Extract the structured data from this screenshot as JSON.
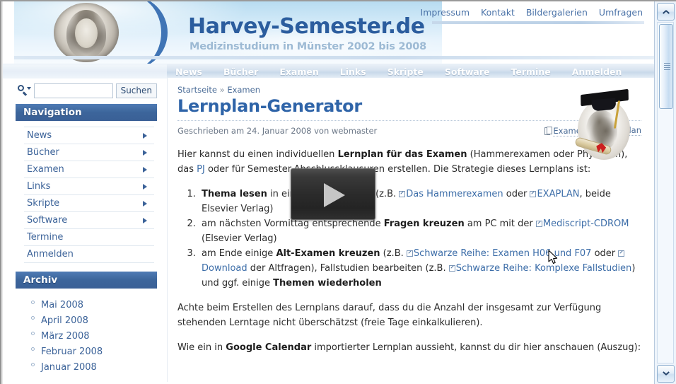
{
  "header": {
    "site_title": "Harvey-Semester.de",
    "site_subtitle": "Medizinstudium in Münster 2002 bis 2008",
    "portrait_alt": "william-harvey-portrait",
    "top_links": [
      {
        "label": "Impressum"
      },
      {
        "label": "Kontakt"
      },
      {
        "label": "Bildergalerien"
      },
      {
        "label": "Umfragen"
      }
    ]
  },
  "navbar": {
    "items": [
      {
        "label": "News"
      },
      {
        "label": "Bücher"
      },
      {
        "label": "Examen"
      },
      {
        "label": "Links"
      },
      {
        "label": "Skripte"
      },
      {
        "label": "Software"
      },
      {
        "label": "Termine"
      },
      {
        "label": "Anmelden"
      }
    ]
  },
  "sidebar": {
    "search": {
      "value": "",
      "placeholder": "",
      "button_label": "Suchen",
      "icon": "search-icon"
    },
    "navigation": {
      "title": "Navigation",
      "items": [
        {
          "label": "News",
          "has_submenu": true
        },
        {
          "label": "Bücher",
          "has_submenu": true
        },
        {
          "label": "Examen",
          "has_submenu": true
        },
        {
          "label": "Links",
          "has_submenu": true
        },
        {
          "label": "Skripte",
          "has_submenu": true
        },
        {
          "label": "Software",
          "has_submenu": true
        },
        {
          "label": "Termine",
          "has_submenu": false
        },
        {
          "label": "Anmelden",
          "has_submenu": false
        }
      ]
    },
    "archive": {
      "title": "Archiv",
      "items": [
        {
          "label": "Mai 2008"
        },
        {
          "label": "April 2008"
        },
        {
          "label": "März 2008"
        },
        {
          "label": "Februar 2008"
        },
        {
          "label": "Januar 2008"
        }
      ]
    }
  },
  "content": {
    "breadcrumb": {
      "home": "Startseite",
      "separator": "»",
      "current": "Examen"
    },
    "title": "Lernplan-Generator",
    "byline": "Geschrieben am 24. Januar 2008 von webmaster",
    "tags": [
      {
        "label": "Examen",
        "icon": "tag-icon"
      },
      {
        "label": "Lernplan",
        "icon": ""
      }
    ],
    "intro": {
      "t1": "Hier kannst du einen individuellen ",
      "b1": "Lernplan für das Examen",
      "t2": " (Hammerexamen oder Physikum), das ",
      "l1": "PJ",
      "t3": " oder für Semester-Abschlussklausuren erstellen. Die Strategie dieses Lernplans ist:"
    },
    "steps": [
      {
        "b1": "Thema lesen",
        "t1": " in einem Repetitorium (z.B. ",
        "l1": "Das Hammerexamen",
        "t2": " oder ",
        "l2": "EXAPLAN",
        "t3": ", beide Elsevier Verlag)"
      },
      {
        "t1": "am nächsten Vormittag entsprechende ",
        "b1": "Fragen kreuzen",
        "t2": " am PC mit der ",
        "l1": "Mediscript-CDROM",
        "t3": " (Elsevier Verlag)"
      },
      {
        "t1": "am Ende einige ",
        "b1": "Alt-Examen kreuzen",
        "t2": " (z.B. ",
        "l1": "Schwarze Reihe: Examen H06 und F07",
        "t3": " oder ",
        "l2": "Download",
        "t4": " der Altfragen), Fallstudien bearbeiten (z.B. ",
        "l3": "Schwarze Reihe: Komplexe Fallstudien",
        "t5": ") und ggf. einige ",
        "b2": "Themen wiederholen"
      }
    ],
    "note": "Achte beim Erstellen des Lernplans darauf, dass du die Anzahl der insgesamt zur Verfügung stehenden Lerntage nicht überschätzst (freie Tage einkalkulieren).",
    "calendar": {
      "t1": "Wie ein in ",
      "b1": "Google Calendar",
      "t2": " importierter Lernplan aussieht, kannst du dir hier anschauen (Auszug):"
    },
    "video_overlay": {
      "icon": "play-icon",
      "label": ""
    },
    "image_alt": "graduate-portrait"
  },
  "scrollbar": {
    "up_icon": "chevron-up-icon",
    "down_icon": "chevron-down-icon",
    "thumb": "scrollbar-thumb"
  },
  "colors": {
    "accent_blue": "#2f64a8",
    "nav_header": "#3c659b",
    "link": "#3c6da8",
    "subtitle_gray": "#9dbad4"
  }
}
